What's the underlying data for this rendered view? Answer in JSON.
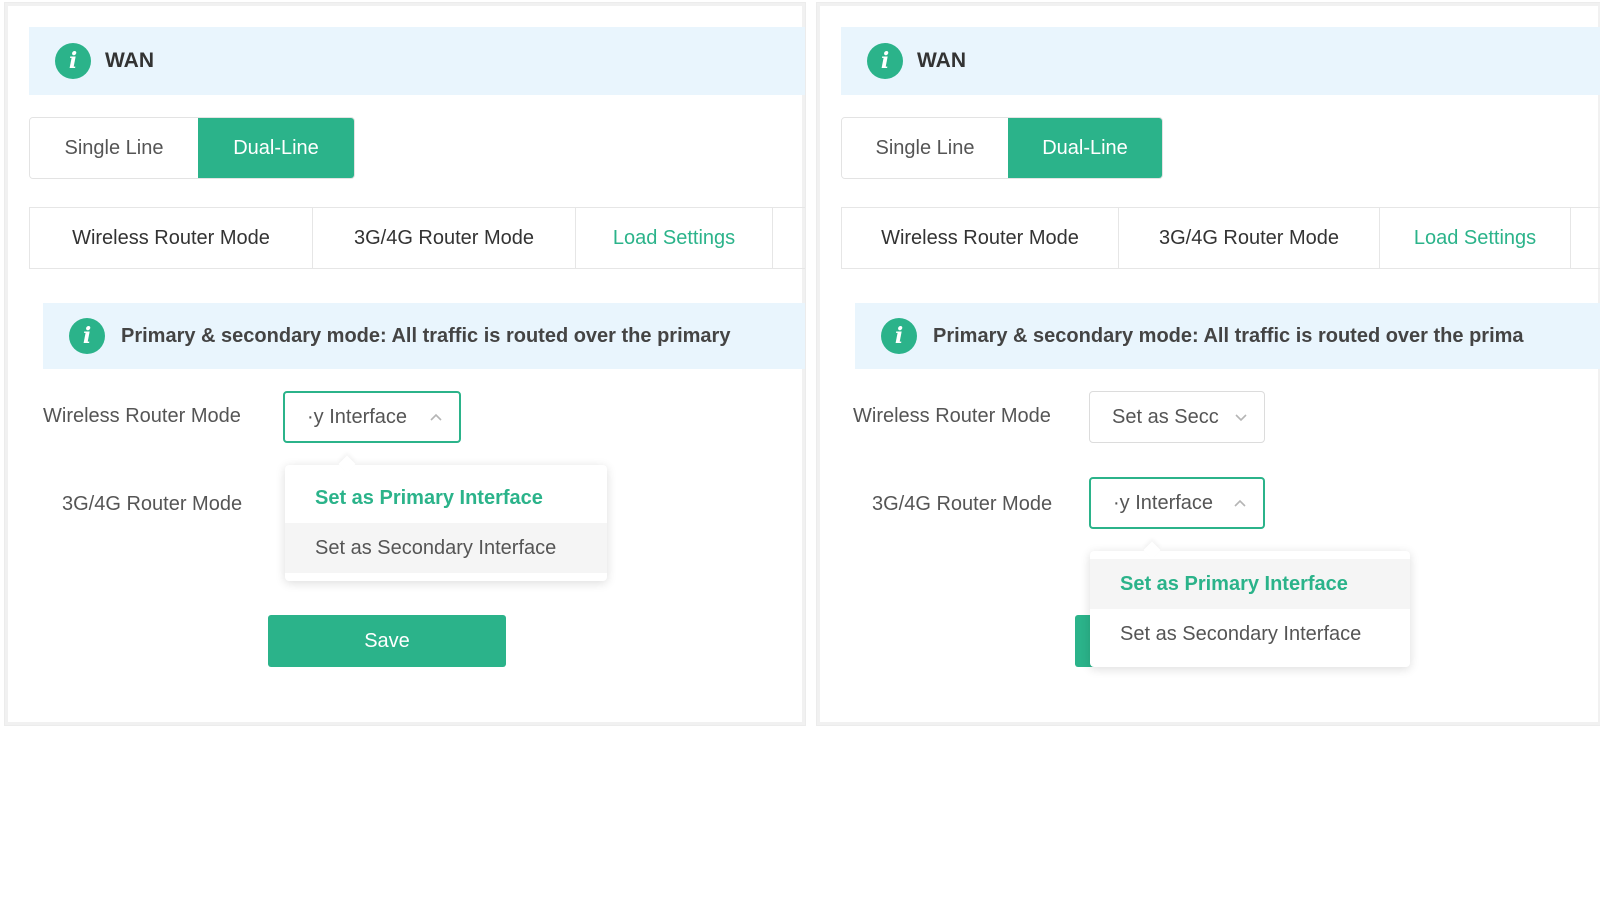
{
  "left": {
    "header": {
      "title": "WAN"
    },
    "line_mode": {
      "single": "Single Line",
      "dual": "Dual-Line"
    },
    "tabs": [
      "Wireless Router Mode",
      "3G/4G Router Mode",
      "Load Settings"
    ],
    "notice": "Primary & secondary mode: All traffic is routed over the primary",
    "wireless_label": "Wireless Router Mode",
    "wireless_value": "·y Interface",
    "g34_label": "3G/4G Router Mode",
    "dropdown": [
      "Set as Primary Interface",
      "Set as Secondary Interface"
    ],
    "save": "Save"
  },
  "right": {
    "header": {
      "title": "WAN"
    },
    "line_mode": {
      "single": "Single Line",
      "dual": "Dual-Line"
    },
    "tabs": [
      "Wireless Router Mode",
      "3G/4G Router Mode",
      "Load Settings"
    ],
    "notice": "Primary & secondary mode: All traffic is routed over the prima",
    "wireless_label": "Wireless Router Mode",
    "wireless_value": "Set as Secc",
    "g34_label": "3G/4G Router Mode",
    "g34_value": "·y Interface",
    "dropdown": [
      "Set as Primary Interface",
      "Set as Secondary Interface"
    ]
  },
  "colors": {
    "accent": "#2bb38a",
    "info_bg": "#e9f5fd"
  },
  "icons": {
    "info": "info-circle-icon",
    "chevron_up": "chevron-up-icon",
    "chevron_down": "chevron-down-icon"
  }
}
